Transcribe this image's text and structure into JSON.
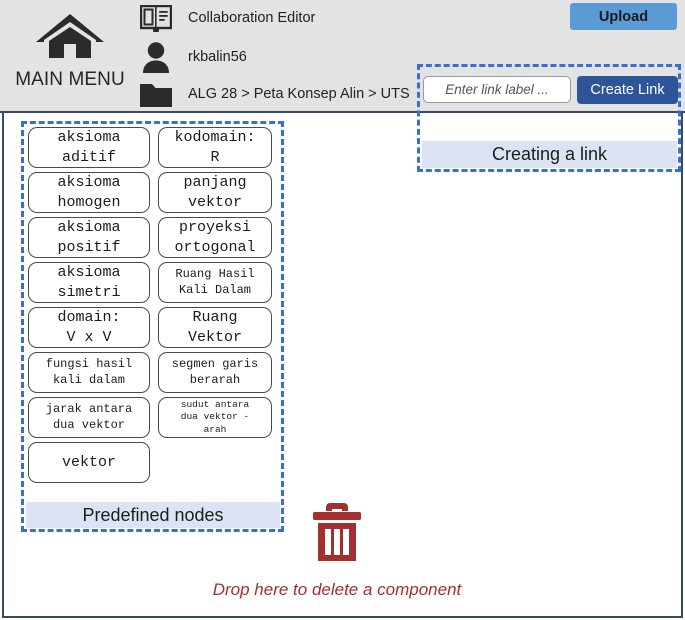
{
  "header": {
    "main_menu_label": "MAIN MENU",
    "home_icon": "home-icon",
    "rows": [
      {
        "icon": "book-icon",
        "text": "Collaboration Editor"
      },
      {
        "icon": "person-icon",
        "text": "rkbalin56"
      },
      {
        "icon": "folder-icon",
        "text": "ALG 28 > Peta Konsep Alin > UTS"
      }
    ],
    "upload_label": "Upload",
    "upload_color": "#5b9bd5",
    "background_color": "#e3e3e3"
  },
  "link_panel": {
    "input_value": "",
    "input_placeholder": "Enter link label ...",
    "create_link_label": "Create Link",
    "create_link_color": "#2e5597",
    "band_label": "Creating a link",
    "band_color": "#dce3f4",
    "border_color": "#3a6ed0"
  },
  "nodes_panel": {
    "band_label": "Predefined nodes",
    "band_color": "#dce3f4",
    "border_color": "#3a6ed0",
    "nodes": [
      {
        "text": "aksioma\naditif",
        "column": "left",
        "size": "lg"
      },
      {
        "text": "kodomain:\nR",
        "column": "right",
        "size": "lg"
      },
      {
        "text": "aksioma\nhomogen",
        "column": "left",
        "size": "lg"
      },
      {
        "text": "panjang\nvektor",
        "column": "right",
        "size": "lg"
      },
      {
        "text": "aksioma\npositif",
        "column": "left",
        "size": "lg"
      },
      {
        "text": "proyeksi\nortogonal",
        "column": "right",
        "size": "lg"
      },
      {
        "text": "aksioma\nsimetri",
        "column": "left",
        "size": "lg"
      },
      {
        "text": "Ruang Hasil\nKali Dalam",
        "column": "right",
        "size": "md"
      },
      {
        "text": "domain:\nV x V",
        "column": "left",
        "size": "lg"
      },
      {
        "text": "Ruang\nVektor",
        "column": "right",
        "size": "lg"
      },
      {
        "text": "fungsi hasil\nkali dalam",
        "column": "left",
        "size": "md"
      },
      {
        "text": "segmen garis\nberarah",
        "column": "right",
        "size": "md"
      },
      {
        "text": "jarak antara\ndua vektor",
        "column": "left",
        "size": "md"
      },
      {
        "text": "sudut antara\ndua vektor -\narah",
        "column": "right",
        "size": "sm"
      },
      {
        "text": "vektor",
        "column": "left",
        "size": "lg"
      }
    ]
  },
  "trash": {
    "icon": "trash-icon",
    "caption": "Drop here to delete a component",
    "color": "#a33030"
  }
}
